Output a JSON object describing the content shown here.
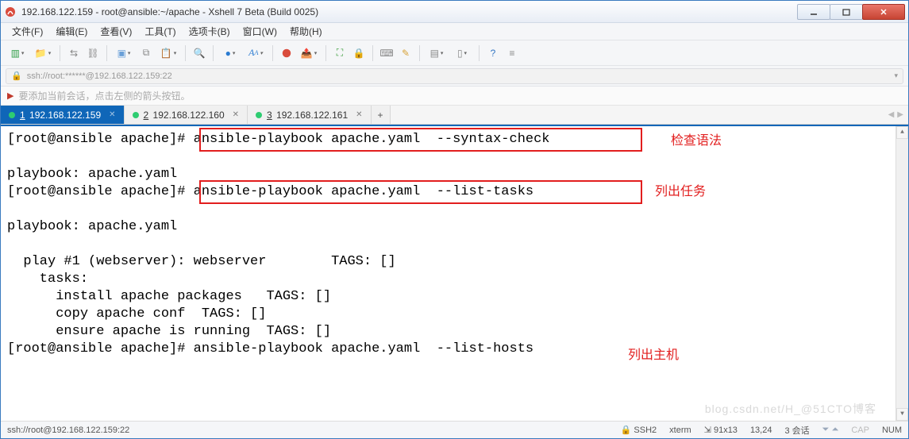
{
  "window": {
    "title": "192.168.122.159 - root@ansible:~/apache - Xshell 7 Beta (Build 0025)"
  },
  "menu": {
    "file": "文件(F)",
    "edit": "编辑(E)",
    "view": "查看(V)",
    "tools": "工具(T)",
    "tabs": "选项卡(B)",
    "window": "窗口(W)",
    "help": "帮助(H)"
  },
  "address": {
    "text": "ssh://root:******@192.168.122.159:22"
  },
  "hint": {
    "text": "要添加当前会话，点击左侧的箭头按钮。"
  },
  "tabs": [
    {
      "num": "1",
      "label": "192.168.122.159",
      "active": true
    },
    {
      "num": "2",
      "label": "192.168.122.160",
      "active": false
    },
    {
      "num": "3",
      "label": "192.168.122.161",
      "active": false
    }
  ],
  "terminal": {
    "lines": [
      "[root@ansible apache]# ansible-playbook apache.yaml  --syntax-check",
      "",
      "playbook: apache.yaml",
      "[root@ansible apache]# ansible-playbook apache.yaml  --list-tasks",
      "",
      "playbook: apache.yaml",
      "",
      "  play #1 (webserver): webserver        TAGS: []",
      "    tasks:",
      "      install apache packages   TAGS: []",
      "      copy apache conf  TAGS: []",
      "      ensure apache is running  TAGS: []",
      "[root@ansible apache]# ansible-playbook apache.yaml  --list-hosts"
    ],
    "annotations": {
      "syntax_check": "检查语法",
      "list_tasks": "列出任务",
      "list_hosts": "列出主机"
    }
  },
  "status": {
    "left": "ssh://root@192.168.122.159:22",
    "proto": "SSH2",
    "term": "xterm",
    "size": "91x13",
    "pos": "13,24",
    "sessions": "3 会话",
    "cap": "CAP",
    "num": "NUM"
  },
  "watermark": "blog.csdn.net/H_@51CTO博客"
}
